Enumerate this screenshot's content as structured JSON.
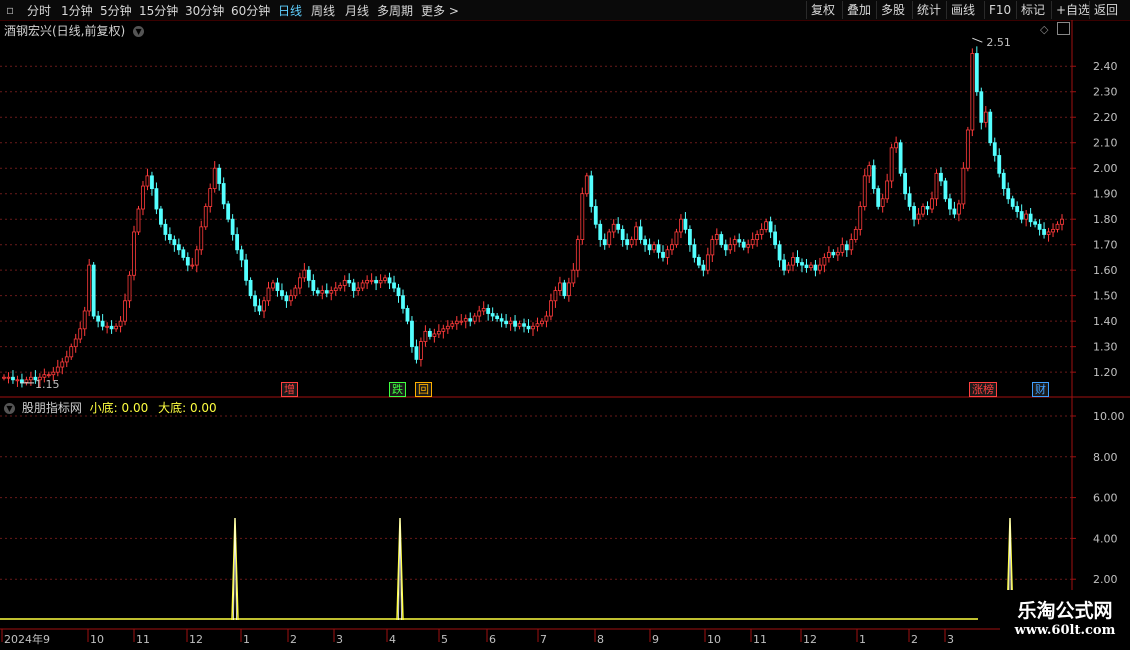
{
  "toolbar": {
    "left": [
      {
        "label": "分时",
        "active": false
      },
      {
        "label": "1分钟",
        "active": false
      },
      {
        "label": "5分钟",
        "active": false
      },
      {
        "label": "15分钟",
        "active": false
      },
      {
        "label": "30分钟",
        "active": false
      },
      {
        "label": "60分钟",
        "active": false
      },
      {
        "label": "日线",
        "active": true
      },
      {
        "label": "周线",
        "active": false
      },
      {
        "label": "月线",
        "active": false
      },
      {
        "label": "多周期",
        "active": false
      },
      {
        "label": "更多 >",
        "active": false
      }
    ],
    "right": [
      "复权",
      "叠加",
      "多股",
      "统计",
      "画线",
      "F10",
      "标记",
      "+自选",
      "返回"
    ]
  },
  "main": {
    "title": "酒钢宏兴(日线,前复权)",
    "ymin_label": "1.15",
    "ymax_label": "2.51",
    "yticks": [
      "2.40",
      "2.30",
      "2.20",
      "2.10",
      "2.00",
      "1.90",
      "1.80",
      "1.70",
      "1.60",
      "1.50",
      "1.40",
      "1.30",
      "1.20"
    ],
    "badges": [
      {
        "label": "增",
        "color": "#ff4040"
      },
      {
        "label": "跌",
        "color": "#40ff40"
      },
      {
        "label": "回",
        "color": "#ffb000"
      },
      {
        "label": "涨榜",
        "color": "#ff4040"
      },
      {
        "label": "财",
        "color": "#40a0ff"
      }
    ]
  },
  "indicator": {
    "name": "股朋指标网",
    "small_label": "小底:",
    "small_value": "0.00",
    "big_label": "大底:",
    "big_value": "0.00",
    "yticks": [
      "10.00",
      "8.00",
      "6.00",
      "4.00",
      "2.00"
    ],
    "spikes": [
      {
        "date_label": "12月中",
        "value": 5
      },
      {
        "date_label": "4月初",
        "value": 5
      },
      {
        "date_label": "3月",
        "value": 5
      }
    ]
  },
  "xaxis": {
    "labels": [
      "2024年9",
      "10",
      "11",
      "12",
      "1",
      "2",
      "3",
      "4",
      "5",
      "6",
      "7",
      "8",
      "9",
      "10",
      "11",
      "12",
      "1",
      "2",
      "3"
    ]
  },
  "watermark": {
    "line1": "乐淘公式网",
    "line2": "www.60lt.com"
  },
  "chart_data": {
    "type": "candlestick",
    "title": "酒钢宏兴(日线,前复权)",
    "ylim": [
      1.13,
      2.55
    ],
    "low_marker": 1.15,
    "high_marker": 2.51,
    "closes": [
      1.18,
      1.18,
      1.17,
      1.17,
      1.16,
      1.17,
      1.18,
      1.17,
      1.18,
      1.19,
      1.19,
      1.2,
      1.22,
      1.24,
      1.26,
      1.3,
      1.33,
      1.37,
      1.44,
      1.62,
      1.42,
      1.4,
      1.38,
      1.38,
      1.37,
      1.38,
      1.4,
      1.48,
      1.58,
      1.75,
      1.84,
      1.93,
      1.97,
      1.92,
      1.84,
      1.78,
      1.74,
      1.72,
      1.7,
      1.68,
      1.65,
      1.62,
      1.62,
      1.68,
      1.77,
      1.85,
      1.92,
      2.0,
      1.94,
      1.86,
      1.8,
      1.74,
      1.68,
      1.64,
      1.56,
      1.5,
      1.46,
      1.44,
      1.48,
      1.53,
      1.55,
      1.52,
      1.5,
      1.48,
      1.5,
      1.53,
      1.57,
      1.6,
      1.56,
      1.52,
      1.51,
      1.52,
      1.51,
      1.52,
      1.53,
      1.54,
      1.56,
      1.55,
      1.52,
      1.53,
      1.55,
      1.56,
      1.56,
      1.55,
      1.56,
      1.57,
      1.55,
      1.53,
      1.5,
      1.45,
      1.4,
      1.3,
      1.25,
      1.32,
      1.36,
      1.34,
      1.35,
      1.36,
      1.37,
      1.38,
      1.39,
      1.4,
      1.4,
      1.41,
      1.4,
      1.42,
      1.44,
      1.45,
      1.43,
      1.42,
      1.41,
      1.4,
      1.39,
      1.4,
      1.38,
      1.39,
      1.38,
      1.37,
      1.38,
      1.39,
      1.4,
      1.42,
      1.48,
      1.52,
      1.55,
      1.5,
      1.55,
      1.6,
      1.72,
      1.9,
      1.97,
      1.85,
      1.78,
      1.72,
      1.7,
      1.75,
      1.78,
      1.76,
      1.72,
      1.7,
      1.72,
      1.77,
      1.72,
      1.7,
      1.68,
      1.7,
      1.67,
      1.65,
      1.68,
      1.7,
      1.75,
      1.8,
      1.76,
      1.7,
      1.65,
      1.62,
      1.6,
      1.66,
      1.72,
      1.74,
      1.7,
      1.68,
      1.7,
      1.72,
      1.71,
      1.69,
      1.7,
      1.72,
      1.74,
      1.76,
      1.79,
      1.75,
      1.7,
      1.64,
      1.6,
      1.62,
      1.65,
      1.63,
      1.62,
      1.61,
      1.62,
      1.6,
      1.62,
      1.65,
      1.67,
      1.66,
      1.67,
      1.7,
      1.68,
      1.72,
      1.76,
      1.85,
      1.97,
      2.01,
      1.92,
      1.85,
      1.88,
      1.95,
      2.08,
      2.1,
      1.98,
      1.9,
      1.85,
      1.8,
      1.82,
      1.85,
      1.84,
      1.88,
      1.98,
      1.95,
      1.88,
      1.84,
      1.82,
      1.86,
      2.0,
      2.15,
      2.45,
      2.3,
      2.18,
      2.22,
      2.1,
      2.05,
      1.98,
      1.92,
      1.88,
      1.85,
      1.83,
      1.8,
      1.82,
      1.79,
      1.78,
      1.76,
      1.74,
      1.75,
      1.76,
      1.78,
      1.8
    ]
  }
}
